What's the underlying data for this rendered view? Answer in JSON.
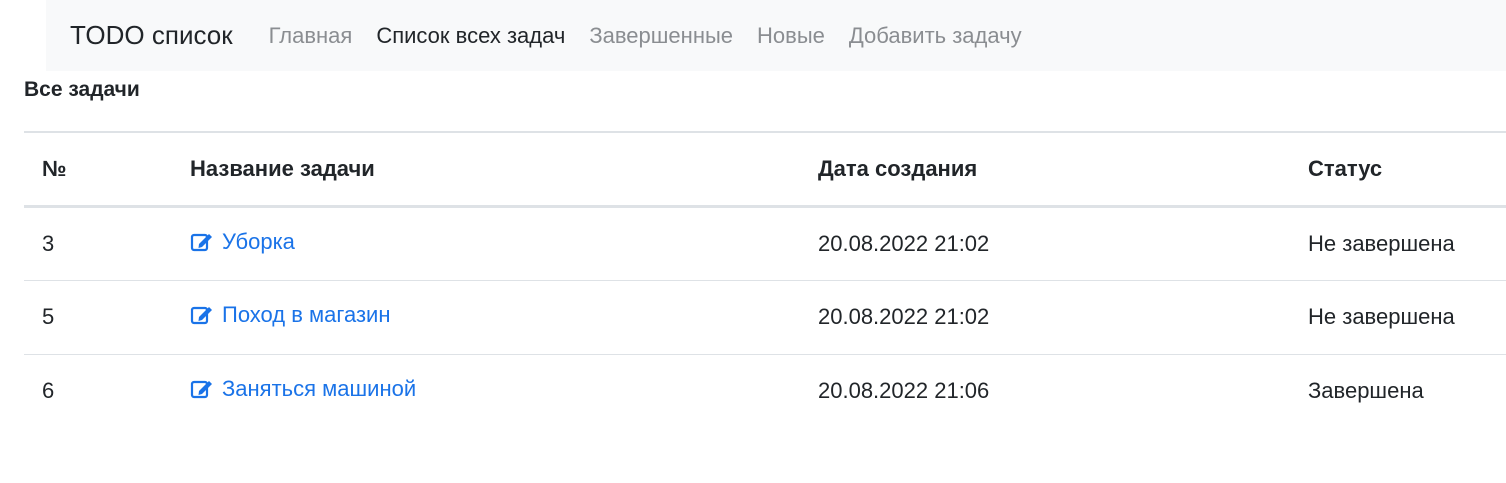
{
  "navbar": {
    "brand": "TODO список",
    "links": [
      {
        "label": "Главная",
        "active": false
      },
      {
        "label": "Список всех задач",
        "active": true
      },
      {
        "label": "Завершенные",
        "active": false
      },
      {
        "label": "Новые",
        "active": false
      },
      {
        "label": "Добавить задачу",
        "active": false
      }
    ]
  },
  "main": {
    "title": "Все задачи",
    "table": {
      "headers": [
        "№",
        "Название задачи",
        "Дата создания",
        "Статус"
      ],
      "rows": [
        {
          "id": "3",
          "name": "Уборка",
          "created": "20.08.2022 21:02",
          "status": "Не завершена"
        },
        {
          "id": "5",
          "name": "Поход в магазин",
          "created": "20.08.2022 21:02",
          "status": "Не завершена"
        },
        {
          "id": "6",
          "name": "Заняться машиной",
          "created": "20.08.2022 21:06",
          "status": "Завершена"
        }
      ]
    }
  },
  "icons": {
    "edit": "edit-icon"
  },
  "colors": {
    "link": "#1a73e8",
    "navbar_bg": "#f8f9fa",
    "nav_inactive": "#8a8d91",
    "text": "#212529"
  }
}
